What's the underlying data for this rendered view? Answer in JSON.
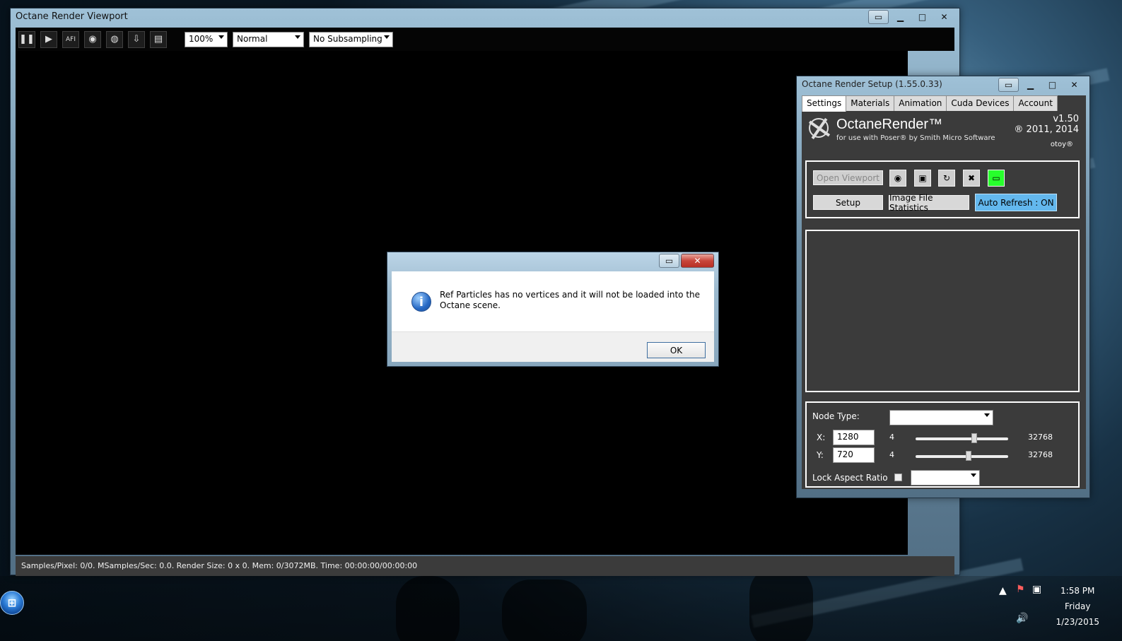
{
  "viewport": {
    "title": "Octane Render Viewport",
    "toolbar": {
      "pause_icon": "pause-icon",
      "play_icon": "play-icon",
      "afi_label": "AFI",
      "zoom": "100%",
      "mode": "Normal",
      "subsampling": "No Subsampling"
    },
    "status": "Samples/Pixel: 0/0. MSamples/Sec: 0.0. Render Size: 0 x 0. Mem: 0/3072MB. Time: 00:00:00/00:00:00"
  },
  "dialog": {
    "message": "Ref Particles has no vertices and it will not be loaded into the Octane scene.",
    "ok_label": "OK"
  },
  "setup": {
    "title": "Octane Render Setup (1.55.0.33)",
    "tabs": [
      {
        "label": "Settings"
      },
      {
        "label": "Materials"
      },
      {
        "label": "Animation"
      },
      {
        "label": "Cuda Devices"
      },
      {
        "label": "Account"
      }
    ],
    "brand": {
      "name": "OctaneRender™",
      "subtitle": "for use with Poser® by Smith Micro Software",
      "version": "v1.50",
      "years": "® 2011, 2014",
      "vendor": "otoy®"
    },
    "buttons": {
      "open_viewport": "Open Viewport",
      "setup": "Setup",
      "image_file_statistics": "Image File Statistics",
      "auto_refresh": "Auto Refresh : ON"
    },
    "node_type_label": "Node Type:",
    "x_label": "X:",
    "x_value": "1280",
    "x_min": "4",
    "x_max": "32768",
    "y_label": "Y:",
    "y_value": "720",
    "y_min": "4",
    "y_max": "32768",
    "lock_aspect_label": "Lock Aspect Ratio"
  },
  "taskbar": {
    "time": "1:58 PM",
    "day": "Friday",
    "date": "1/23/2015"
  }
}
